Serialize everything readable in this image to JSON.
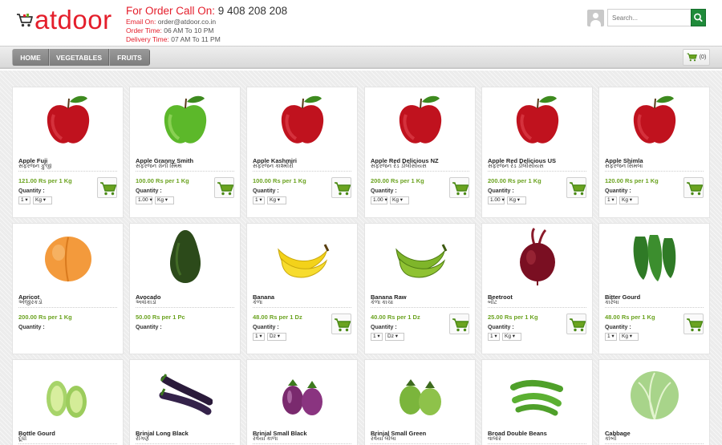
{
  "header": {
    "logo_text": "atdoor",
    "call_label": "For Order Call On:",
    "call_number": "9 408 208 208",
    "email_label": "Email On:",
    "email_value": "order@atdoor.co.in",
    "order_time_label": "Order Time:",
    "order_time_value": "06 AM To 10 PM",
    "delivery_time_label": "Delivery Time:",
    "delivery_time_value": "07 AM To 11 PM",
    "search_placeholder": "Search..."
  },
  "nav": {
    "items": [
      "HOME",
      "VEGETABLES",
      "FRUITS"
    ],
    "cart_count": "(0)"
  },
  "colors": {
    "brand_red": "#e41e2b",
    "price_green": "#6ba320",
    "search_button_green": "#1f8b3a",
    "nav_gray": "#8a8a8a"
  },
  "products": [
    {
      "name": "Apple Fuji",
      "gujarati": "સફરજન ફુજી",
      "price": "121.00 Rs per 1 Kg",
      "qty_label": "Quantity :",
      "qty": "1",
      "unit": "Kg",
      "has_cart": true,
      "icon": "red-apple"
    },
    {
      "name": "Apple Granny Smith",
      "gujarati": "સફરજન ગ્રેની સ્મિથ",
      "price": "100.00 Rs per 1 Kg",
      "qty_label": "Quantity :",
      "qty": "1.00",
      "unit": "Kg",
      "has_cart": true,
      "icon": "green-apple"
    },
    {
      "name": "Apple Kashmiri",
      "gujarati": "સફરજન કાશ્મીરી",
      "price": "100.00 Rs per 1 Kg",
      "qty_label": "Quantity :",
      "qty": "1",
      "unit": "Kg",
      "has_cart": true,
      "icon": "red-apple"
    },
    {
      "name": "Apple Red Delicious NZ",
      "gujarati": "સફરજન રેડ ડીલીસીયસ",
      "price": "200.00 Rs per 1 Kg",
      "qty_label": "Quantity :",
      "qty": "1.00",
      "unit": "Kg",
      "has_cart": true,
      "icon": "red-apple"
    },
    {
      "name": "Apple Red Delicious US",
      "gujarati": "સફરજન રેડ ડીલીસીયસ",
      "price": "200.00 Rs per 1 Kg",
      "qty_label": "Quantity :",
      "qty": "1.00",
      "unit": "Kg",
      "has_cart": true,
      "icon": "red-apple"
    },
    {
      "name": "Apple Shimla",
      "gujarati": "સફરજન સિમલા",
      "price": "120.00 Rs per 1 Kg",
      "qty_label": "Quantity :",
      "qty": "1",
      "unit": "Kg",
      "has_cart": true,
      "icon": "red-apple"
    },
    {
      "name": "Apricot",
      "gujarati": "અંજીરકડો",
      "price": "200.00 Rs per 1 Kg",
      "qty_label": "Quantity :",
      "qty": "",
      "unit": "",
      "has_cart": false,
      "icon": "apricot"
    },
    {
      "name": "Avocado",
      "gujarati": "અવોકાડો",
      "price": "50.00 Rs per 1 Pc",
      "qty_label": "Quantity :",
      "qty": "",
      "unit": "",
      "has_cart": false,
      "icon": "avocado"
    },
    {
      "name": "Banana",
      "gujarati": "કેળા",
      "price": "48.00 Rs per 1 Dz",
      "qty_label": "Quantity :",
      "qty": "1",
      "unit": "Dz",
      "has_cart": true,
      "icon": "banana"
    },
    {
      "name": "Banana Raw",
      "gujarati": "કેળા કાચા",
      "price": "40.00 Rs per 1 Dz",
      "qty_label": "Quantity :",
      "qty": "1",
      "unit": "Dz",
      "has_cart": true,
      "icon": "green-banana"
    },
    {
      "name": "Beetroot",
      "gujarati": "બીટ",
      "price": "25.00 Rs per 1 Kg",
      "qty_label": "Quantity :",
      "qty": "1",
      "unit": "Kg",
      "has_cart": true,
      "icon": "beetroot"
    },
    {
      "name": "Bitter Gourd",
      "gujarati": "કારેલા",
      "price": "48.00 Rs per 1 Kg",
      "qty_label": "Quantity :",
      "qty": "1",
      "unit": "Kg",
      "has_cart": true,
      "icon": "bitter-gourd"
    },
    {
      "name": "Bottle Gourd",
      "gujarati": "દૂધી",
      "price": "",
      "qty_label": "",
      "qty": "",
      "unit": "",
      "has_cart": false,
      "icon": "bottle-gourd"
    },
    {
      "name": "Brinjal Long Black",
      "gujarati": "રીંગણ",
      "price": "",
      "qty_label": "",
      "qty": "",
      "unit": "",
      "has_cart": false,
      "icon": "brinjal-long"
    },
    {
      "name": "Brinjal Small Black",
      "gujarati": "રવૈયા કાળા",
      "price": "",
      "qty_label": "",
      "qty": "",
      "unit": "",
      "has_cart": false,
      "icon": "brinjal-small"
    },
    {
      "name": "Brinjal Small Green",
      "gujarati": "રવૈયા લીલા",
      "price": "",
      "qty_label": "",
      "qty": "",
      "unit": "",
      "has_cart": false,
      "icon": "brinjal-green"
    },
    {
      "name": "Broad Double Beans",
      "gujarati": "વાલોર",
      "price": "",
      "qty_label": "",
      "qty": "",
      "unit": "",
      "has_cart": false,
      "icon": "beans"
    },
    {
      "name": "Cabbage",
      "gujarati": "કોબી",
      "price": "",
      "qty_label": "",
      "qty": "",
      "unit": "",
      "has_cart": false,
      "icon": "cabbage"
    }
  ]
}
